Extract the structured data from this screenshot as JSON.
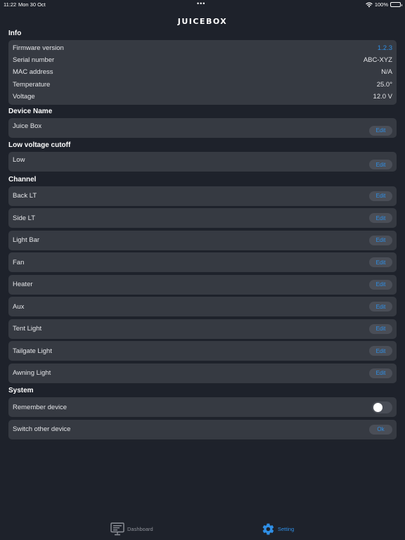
{
  "status_bar": {
    "time": "11:22",
    "date": "Mon 30 Oct",
    "dots": "•••",
    "battery": "100%",
    "battery_level": 1.0
  },
  "app": {
    "title": "JUICEBOX"
  },
  "sections": {
    "info": "Info",
    "device_name": "Device Name",
    "low_voltage": "Low voltage cutoff",
    "channel": "Channel",
    "system": "System"
  },
  "info": {
    "firmware_label": "Firmware version",
    "firmware_value": "1.2.3",
    "serial_label": "Serial number",
    "serial_value": "ABC-XYZ",
    "mac_label": "MAC address",
    "mac_value": "N/A",
    "temp_label": "Temperature",
    "temp_value": "25.0°",
    "voltage_label": "Voltage",
    "voltage_value": "12.0 V"
  },
  "device_name": {
    "value": "Juice Box",
    "button": "Edit"
  },
  "low_voltage": {
    "value": "Low",
    "button": "Edit"
  },
  "channels": {
    "back_lt": "Back LT",
    "side_lt": "Side LT",
    "light_bar": "Light Bar",
    "fan": "Fan",
    "heater": "Heater",
    "aux": "Aux",
    "tent_light": "Tent Light",
    "tailgate_light": "Tailgate Light",
    "awning_light": "Awning Light",
    "button": "Edit"
  },
  "system": {
    "remember_label": "Remember device",
    "remember_on": false,
    "switch_label": "Switch other device",
    "switch_button": "Ok"
  },
  "tabs": {
    "dashboard": "Dashboard",
    "setting": "Setting",
    "active": "setting"
  },
  "colors": {
    "background": "#1e222b",
    "card": "#363a42",
    "accent": "#2f8fe6"
  }
}
